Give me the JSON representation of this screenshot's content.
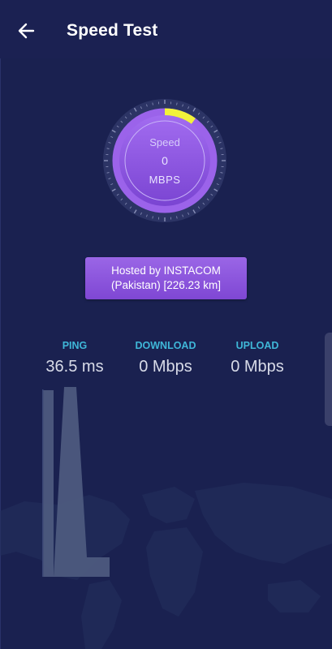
{
  "appbar": {
    "title": "Speed Test",
    "back_icon": "arrow-left-icon"
  },
  "gauge": {
    "label": "Speed",
    "value": "0",
    "unit": "MBPS",
    "progress_fraction": 0.1,
    "accent_color": "#f2f23a",
    "ring_color": "#9b63ea"
  },
  "server": {
    "line1": "Hosted by INSTACOM",
    "line2": "(Pakistan) [226.23 km]"
  },
  "stats": {
    "ping_label": "PING",
    "ping_value": "36.5 ms",
    "download_label": "DOWNLOAD",
    "download_value": "0 Mbps",
    "upload_label": "UPLOAD",
    "upload_value": "0 Mbps"
  },
  "colors": {
    "background": "#1a2150",
    "label_color": "#3fb7d8",
    "chart_fill": "#4d5a7e"
  }
}
